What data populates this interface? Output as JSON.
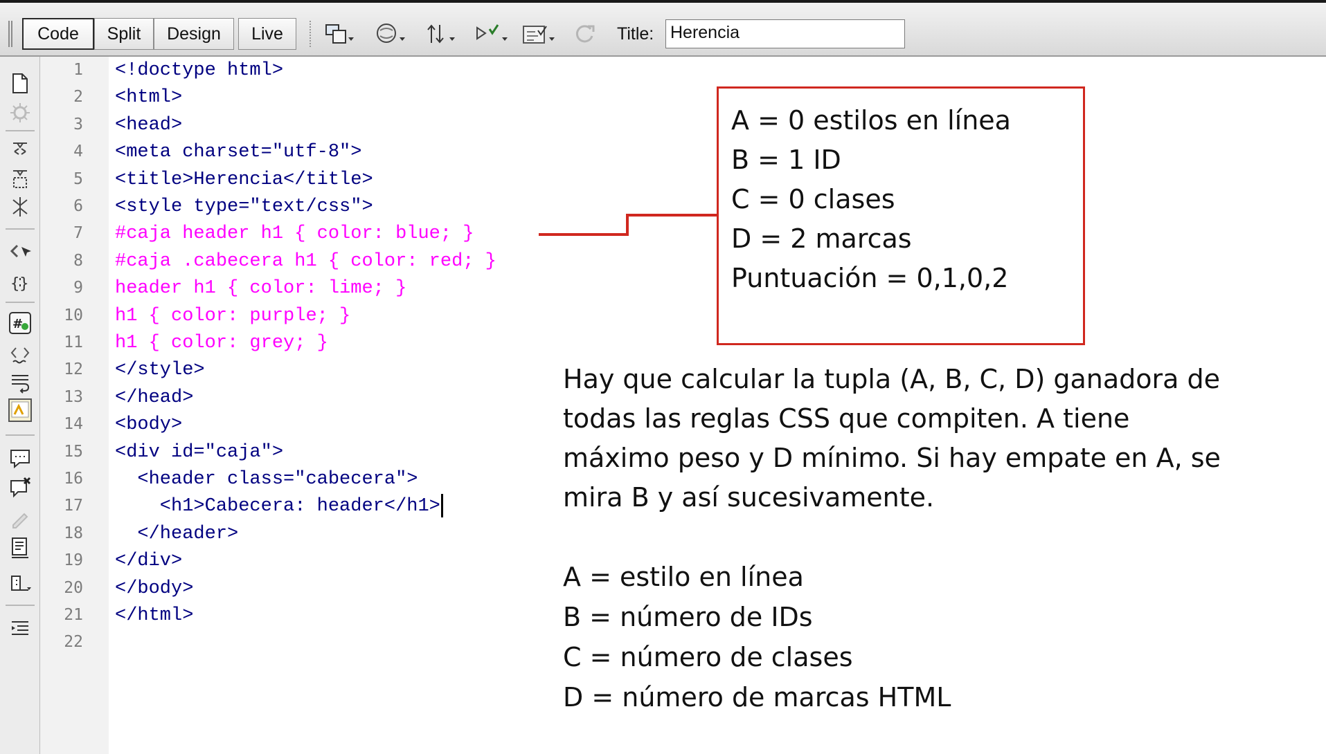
{
  "toolbar": {
    "view_buttons": [
      "Code",
      "Split",
      "Design",
      "Live"
    ],
    "title_label": "Title:",
    "title_value": "Herencia",
    "icons": [
      "multiscreen-icon",
      "browser-preview-icon",
      "file-management-icon",
      "check-page-icon",
      "visual-aids-icon",
      "refresh-icon"
    ]
  },
  "sidebar": {
    "icons": [
      "open-documents-icon",
      "show-code-navigator-icon",
      "collapse-full-tag-icon",
      "collapse-selection-icon",
      "expand-all-icon",
      "select-parent-tag-icon",
      "balance-braces-icon",
      "line-numbers-icon",
      "highlight-invalid-code-icon",
      "word-wrap-icon",
      "syntax-coloring-icon",
      "apply-comment-icon",
      "remove-comment-icon",
      "wrap-tag-icon",
      "recent-snippets-icon",
      "move-css-icon",
      "format-source-icon"
    ]
  },
  "editor": {
    "line_numbers": [
      "1",
      "2",
      "3",
      "4",
      "5",
      "6",
      "7",
      "8",
      "9",
      "10",
      "11",
      "12",
      "13",
      "14",
      "15",
      "16",
      "17",
      "18",
      "19",
      "20",
      "21",
      "22"
    ],
    "lines": [
      {
        "text": "<!doctype html>",
        "kind": "tag"
      },
      {
        "text": "<html>",
        "kind": "tag"
      },
      {
        "text": "<head>",
        "kind": "tag"
      },
      {
        "text": "<meta charset=\"utf-8\">",
        "kind": "tag"
      },
      {
        "text": "<title>Herencia</title>",
        "kind": "tag"
      },
      {
        "text": "<style type=\"text/css\">",
        "kind": "tag"
      },
      {
        "text": "#caja header h1 { color: blue; }",
        "kind": "rule"
      },
      {
        "text": "#caja .cabecera h1 { color: red; }",
        "kind": "rule"
      },
      {
        "text": "header h1 { color: lime; }",
        "kind": "rule"
      },
      {
        "text": "h1 { color: purple; }",
        "kind": "rule"
      },
      {
        "text": "h1 { color: grey; }",
        "kind": "rule"
      },
      {
        "text": "</style>",
        "kind": "tag"
      },
      {
        "text": "</head>",
        "kind": "tag"
      },
      {
        "text": "<body>",
        "kind": "tag"
      },
      {
        "text": "<div id=\"caja\">",
        "kind": "tag"
      },
      {
        "text": "  <header class=\"cabecera\">",
        "kind": "tag"
      },
      {
        "text": "    <h1>Cabecera: header</h1>",
        "kind": "tag"
      },
      {
        "text": "  </header>",
        "kind": "tag"
      },
      {
        "text": "</div>",
        "kind": "tag"
      },
      {
        "text": "</body>",
        "kind": "tag"
      },
      {
        "text": "</html>",
        "kind": "tag"
      },
      {
        "text": "",
        "kind": "tag"
      }
    ]
  },
  "callout": {
    "lines": [
      "A = 0 estilos en línea",
      "B = 1 ID",
      "C = 0 clases",
      "D = 2 marcas",
      "Puntuación = 0,1,0,2"
    ]
  },
  "explanation": {
    "lines": [
      "Hay que calcular la tupla (A, B, C, D) ganadora de",
      "todas las reglas CSS que compiten. A tiene",
      "máximo peso y D mínimo. Si hay empate en A, se",
      "mira B y así sucesivamente."
    ]
  },
  "legend": {
    "lines": [
      "A = estilo en línea",
      "B = número de IDs",
      "C = número de clases",
      "D = número de marcas HTML"
    ]
  },
  "colors": {
    "tag": "#000080",
    "rule": "#ff00ff",
    "callout_border": "#d0281f"
  }
}
